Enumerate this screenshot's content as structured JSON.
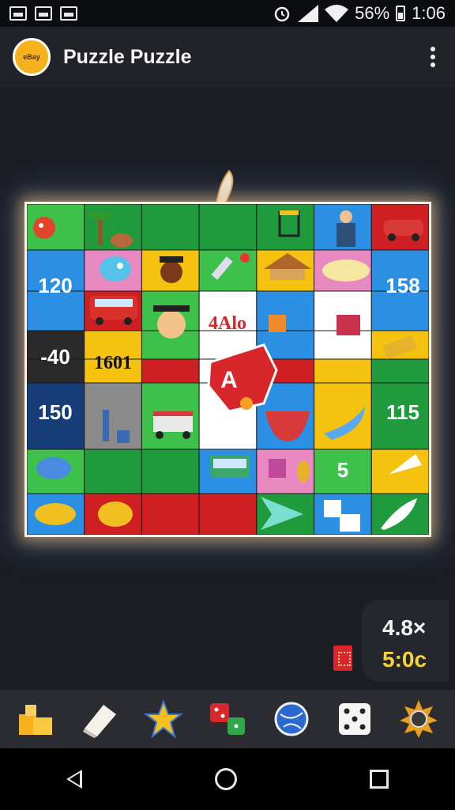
{
  "status_bar": {
    "battery": "56%",
    "time": "1:06",
    "icons": [
      "gallery-icon",
      "n-icon",
      "sim-icon",
      "alarm-icon",
      "signal-icon",
      "wifi-icon",
      "battery-icon"
    ]
  },
  "app_bar": {
    "title": "Puzzle Puzzle",
    "logo_text": "eBay",
    "menu_icon": "more-vert-icon"
  },
  "board": {
    "columns": 7,
    "rows": 8,
    "colors": {
      "green": "#1f9b3d",
      "lightgreen": "#3ec14a",
      "blue": "#2b8fe3",
      "darkblue": "#173d78",
      "red": "#d01f22",
      "yellow": "#f5c20f",
      "pink": "#e889c2",
      "grey": "#8a8a8a",
      "dark": "#2a2a2a",
      "white": "#ffffff"
    },
    "labels": {
      "c120": "120",
      "c158": "158",
      "cm40": "-40",
      "c1601": "1601",
      "c4alo": "4Alo",
      "c150": "150",
      "c115": "115",
      "c5": "5",
      "ca": "A"
    }
  },
  "score_panel": {
    "multiplier": "4.8×",
    "timer": "5:0c"
  },
  "toolbar": {
    "tools": [
      "blocks-icon",
      "eraser-icon",
      "star-icon",
      "dice-pair-icon",
      "globe-icon",
      "dice-icon",
      "sun-gear-icon"
    ]
  },
  "nav": {
    "icons": [
      "back-icon",
      "home-icon",
      "recent-icon"
    ]
  }
}
